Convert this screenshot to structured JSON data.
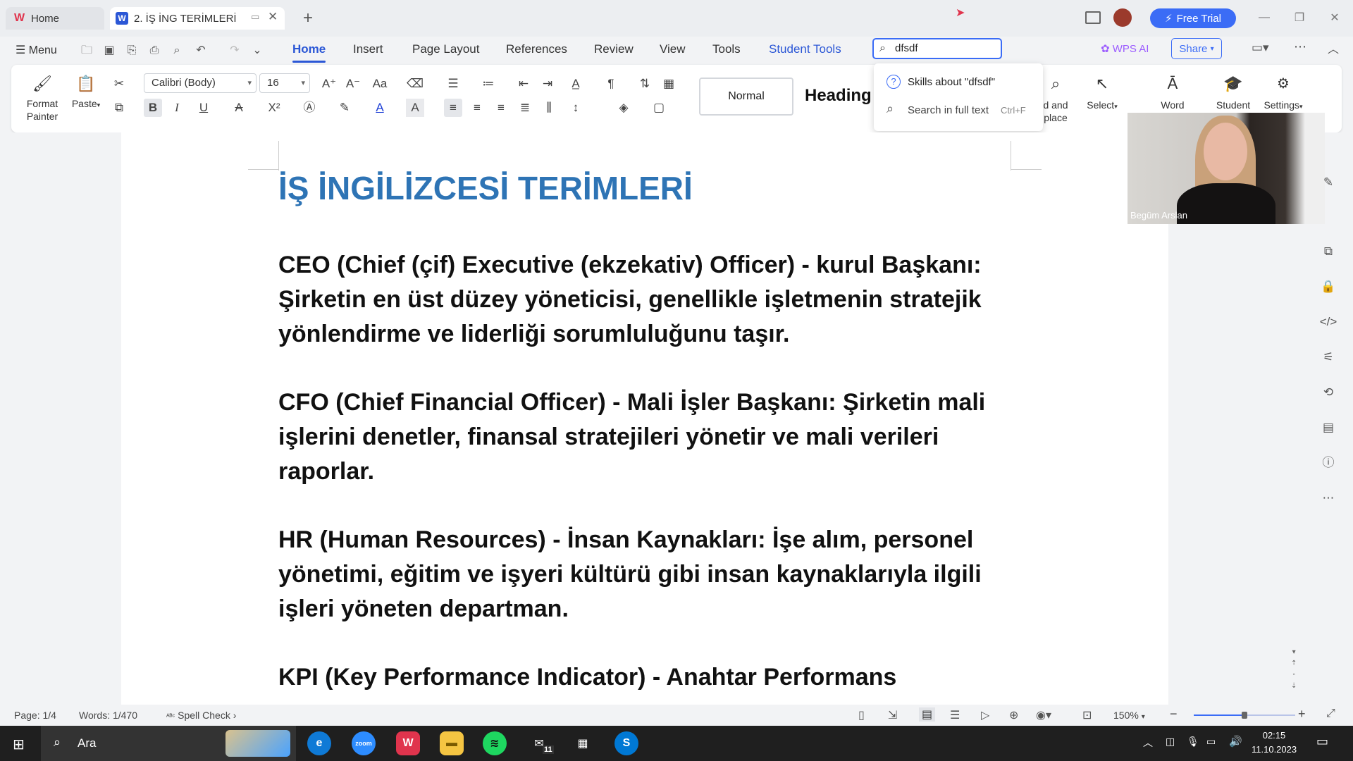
{
  "tabs": {
    "home": "Home",
    "doc": "2. İŞ İNG TERİMLERİ"
  },
  "titlebar": {
    "free_trial": "Free Trial"
  },
  "menu": {
    "menu_label": "Menu",
    "tabs": [
      "Home",
      "Insert",
      "Page Layout",
      "References",
      "Review",
      "View",
      "Tools",
      "Student Tools"
    ],
    "search_value": "dfsdf",
    "wps_ai": "WPS AI",
    "share": "Share"
  },
  "ribbon": {
    "format_painter_1": "Format",
    "format_painter_2": "Painter",
    "paste": "Paste",
    "font_name": "Calibri (Body)",
    "font_size": "16",
    "style_normal": "Normal",
    "style_heading": "Heading",
    "find_replace_1": "d and",
    "find_replace_2": "place",
    "select": "Select",
    "word": "Word",
    "student": "Student",
    "settings": "Settings"
  },
  "search_dropdown": {
    "skills": "Skills about \"dfsdf\"",
    "full_text": "Search in full text",
    "shortcut": "Ctrl+F"
  },
  "webcam": {
    "name": "Begüm Arslan"
  },
  "document": {
    "title": "İŞ İNGİLİZCESİ TERİMLERİ",
    "paragraphs": [
      "CEO (Chief (çif) Executive (ekzekativ) Officer) - kurul Başkanı: Şirketin en üst düzey yöneticisi, genellikle işletmenin stratejik yönlendirme ve liderliği sorumluluğunu taşır.",
      "CFO (Chief Financial Officer) - Mali İşler Başkanı: Şirketin mali işlerini denetler, finansal stratejileri yönetir ve mali verileri raporlar.",
      "HR (Human Resources) - İnsan Kaynakları: İşe alım, personel yönetimi, eğitim ve işyeri kültürü gibi insan kaynaklarıyla ilgili işleri yöneten departman.",
      "KPI (Key Performance Indicator) - Anahtar Performans"
    ]
  },
  "status": {
    "page": "Page: 1/4",
    "words": "Words: 1/470",
    "spell_check": "Spell Check",
    "zoom": "150%"
  },
  "taskbar": {
    "search": "Ara",
    "mail_badge": "11",
    "time": "02:15",
    "date": "11.10.2023"
  }
}
